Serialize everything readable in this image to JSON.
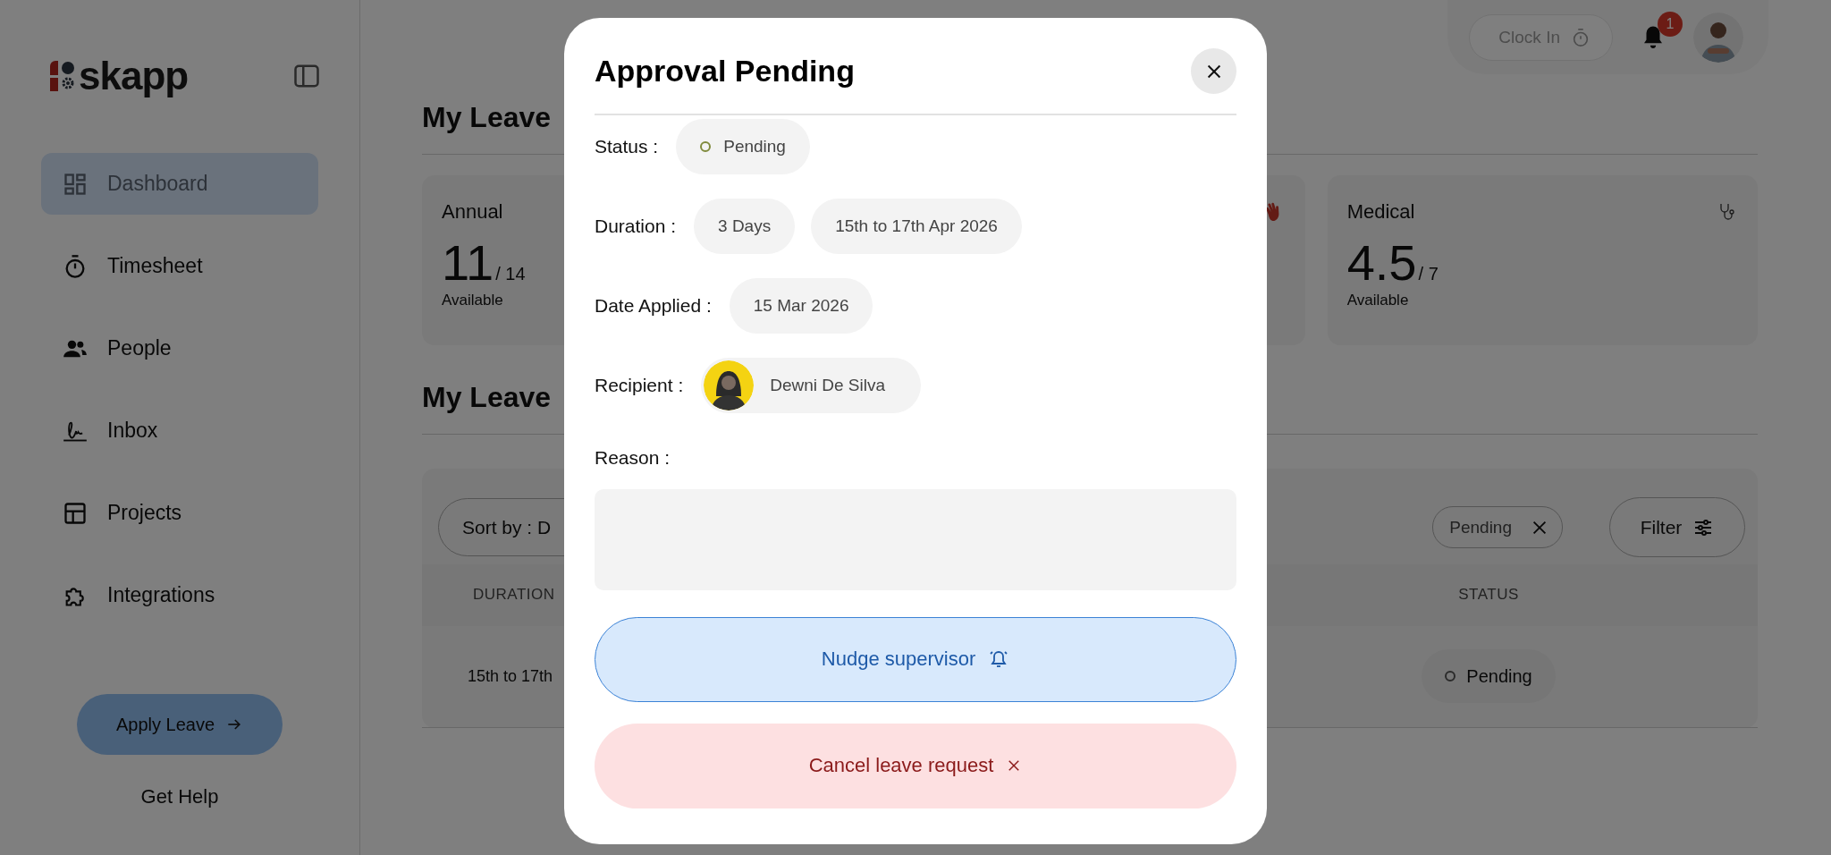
{
  "sidebar": {
    "logo": "skapp",
    "items": [
      {
        "label": "Dashboard",
        "selected": true
      },
      {
        "label": "Timesheet",
        "selected": false
      },
      {
        "label": "People",
        "selected": false
      },
      {
        "label": "Inbox",
        "selected": false
      },
      {
        "label": "Projects",
        "selected": false
      },
      {
        "label": "Integrations",
        "selected": false
      }
    ],
    "apply_button": "Apply Leave",
    "help_link": "Get Help"
  },
  "header": {
    "clock_in": "Clock In",
    "notification_count": "1"
  },
  "leave_allocation": {
    "heading": "My Leave",
    "cards": [
      {
        "kind": "balance",
        "title": "Annual",
        "value": "11",
        "total": "/ 14",
        "caption": "Available"
      },
      {
        "kind": "covered"
      },
      {
        "kind": "balance",
        "title": "Medical",
        "value": "4.5",
        "total": "/ 7",
        "caption": "Available"
      }
    ]
  },
  "leave_requests": {
    "heading": "My Leave",
    "sort": "Sort by : D",
    "filter_chip": "Pending",
    "filter_button": "Filter",
    "columns": [
      "DURATION",
      "STATUS"
    ],
    "rows": [
      {
        "duration": "15th to 17th",
        "status": "Pending"
      }
    ]
  },
  "modal": {
    "title": "Approval Pending",
    "status_label": "Status :",
    "status": "Pending",
    "duration_label": "Duration :",
    "duration_days": "3 Days",
    "duration_range": "15th to 17th Apr 2026",
    "date_label": "Date Applied :",
    "date_applied": "15 Mar 2026",
    "recipient_label": "Recipient :",
    "recipient": "Dewni De Silva",
    "reason_label": "Reason :",
    "nudge_button": "Nudge supervisor",
    "cancel_button": "Cancel leave request"
  }
}
